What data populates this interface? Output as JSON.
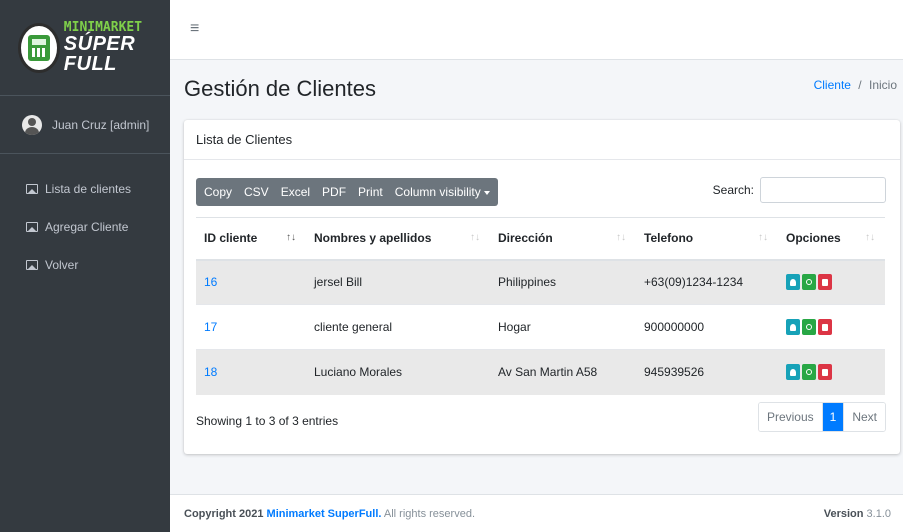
{
  "brand": {
    "line1": "MINIMARKET",
    "line2": "SÚPER FULL"
  },
  "user": {
    "name": "Juan Cruz [admin]"
  },
  "sidebar": {
    "items": [
      {
        "label": "Lista de clientes",
        "icon": "image-icon"
      },
      {
        "label": "Agregar Cliente",
        "icon": "image-icon"
      },
      {
        "label": "Volver",
        "icon": "image-icon"
      }
    ]
  },
  "topbar": {
    "menu_icon": "≡"
  },
  "page": {
    "title": "Gestión de Clientes",
    "breadcrumb": {
      "link": "Cliente",
      "separator": "/",
      "current": "Inicio"
    }
  },
  "card": {
    "title": "Lista de Clientes",
    "toolbar": [
      "Copy",
      "CSV",
      "Excel",
      "PDF",
      "Print",
      "Column visibility"
    ],
    "search": {
      "label": "Search:",
      "value": "",
      "placeholder": ""
    },
    "columns": [
      "ID cliente",
      "Nombres y apellidos",
      "Dirección",
      "Telefono",
      "Opciones"
    ],
    "rows": [
      {
        "id": "16",
        "name": "jersel Bill",
        "address": "Philippines",
        "phone": "+63(09)1234-1234"
      },
      {
        "id": "17",
        "name": "cliente general",
        "address": "Hogar",
        "phone": "900000000"
      },
      {
        "id": "18",
        "name": "Luciano Morales",
        "address": "Av San Martin A58",
        "phone": "945939526"
      }
    ],
    "info": "Showing 1 to 3 of 3 entries",
    "pagination": {
      "previous": "Previous",
      "current": "1",
      "next": "Next"
    }
  },
  "footer": {
    "prefix": "Copyright 2021",
    "brand": "Minimarket SuperFull.",
    "suffix": "All rights reserved.",
    "version_label": "Version",
    "version": "3.1.0"
  },
  "colors": {
    "sidebar": "#343a40",
    "primary": "#007bff",
    "info": "#17a2b8",
    "success": "#28a745",
    "danger": "#dc3545",
    "toolbar": "#6c757d"
  }
}
